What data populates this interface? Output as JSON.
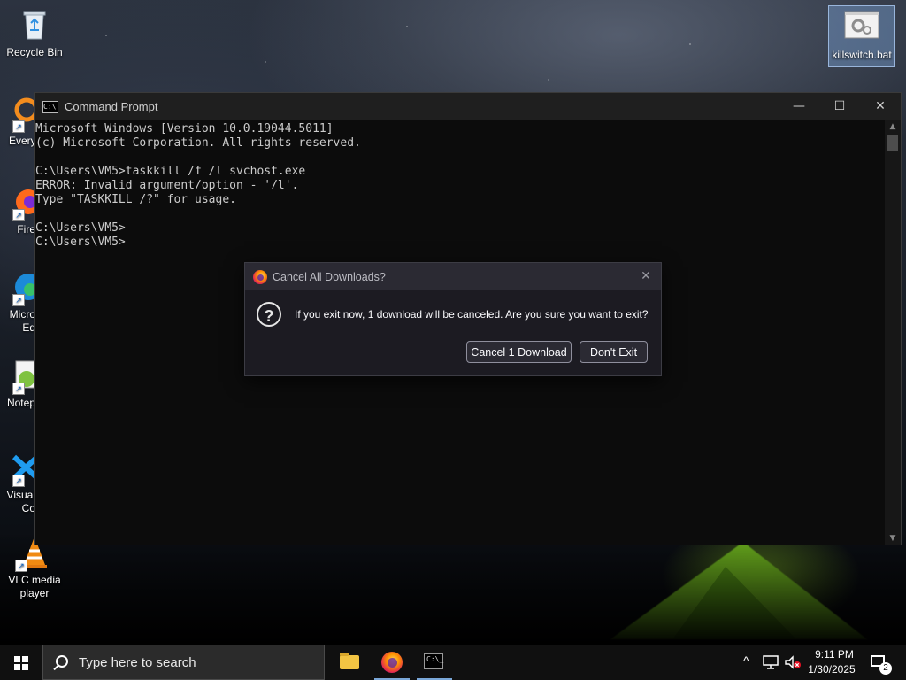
{
  "desktop": {
    "icons": [
      {
        "label": "Recycle Bin"
      },
      {
        "label": "Every"
      },
      {
        "label": "Fire"
      },
      {
        "label": "Micro Ed"
      },
      {
        "label": "Notep"
      },
      {
        "label": "Visual Co"
      },
      {
        "label": "VLC media player"
      },
      {
        "label": "killswitch.bat"
      }
    ]
  },
  "cmd": {
    "title": "Command Prompt",
    "lines": [
      "Microsoft Windows [Version 10.0.19044.5011]",
      "(c) Microsoft Corporation. All rights reserved.",
      "",
      "C:\\Users\\VM5>taskkill /f /l svchost.exe",
      "ERROR: Invalid argument/option - '/l'.",
      "Type \"TASKKILL /?\" for usage.",
      "",
      "C:\\Users\\VM5>",
      "C:\\Users\\VM5>"
    ],
    "controls": {
      "minimize": "—",
      "maximize": "☐",
      "close": "✕"
    }
  },
  "dialog": {
    "title": "Cancel All Downloads?",
    "message": "If you exit now, 1 download will be canceled. Are you sure you want to exit?",
    "confirm_label": "Cancel 1 Download",
    "cancel_label": "Don't Exit",
    "close_glyph": "✕",
    "icon_glyph": "?"
  },
  "taskbar": {
    "search_placeholder": "Type here to search",
    "time": "9:11 PM",
    "date": "1/30/2025",
    "notification_count": "2",
    "tray_up_glyph": "^"
  },
  "colors": {
    "accent": "#7aa7d8",
    "cmd_bg": "#0c0c0c",
    "dialog_bg": "#1c1b22"
  }
}
